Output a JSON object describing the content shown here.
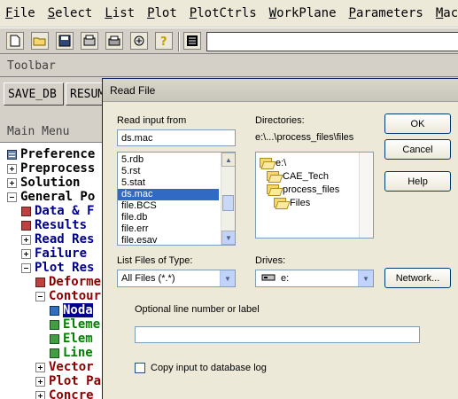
{
  "menubar": {
    "items": [
      "File",
      "Select",
      "List",
      "Plot",
      "PlotCtrls",
      "WorkPlane",
      "Parameters",
      "Macro"
    ]
  },
  "toolstrip": {
    "icons": [
      "new-file-icon",
      "open-file-icon",
      "save-icon",
      "print-setup-icon",
      "print-icon",
      "report-icon",
      "help-icon",
      "command-window-icon"
    ]
  },
  "toolbar": {
    "label": "Toolbar",
    "buttons": [
      "SAVE_DB",
      "RESUM"
    ]
  },
  "main_menu": {
    "label": "Main Menu",
    "items": [
      {
        "label": "Preference"
      },
      {
        "label": "Preprocess"
      },
      {
        "label": "Solution"
      },
      {
        "label": "General Po"
      },
      {
        "label": "Data & F"
      },
      {
        "label": "Results"
      },
      {
        "label": "Read Res"
      },
      {
        "label": "Failure"
      },
      {
        "label": "Plot Res"
      },
      {
        "label": "Deforme"
      },
      {
        "label": "Contour"
      },
      {
        "label": "Noda"
      },
      {
        "label": "Eleme"
      },
      {
        "label": "Elem"
      },
      {
        "label": "Line"
      },
      {
        "label": "Vector"
      },
      {
        "label": "Plot Pa"
      },
      {
        "label": "Concre"
      }
    ]
  },
  "dialog": {
    "title": "Read File",
    "read_input_label": "Read input from",
    "read_input_value": "ds.mac",
    "files": [
      "5.rdb",
      "5.rst",
      "5.stat",
      "ds.mac",
      "file.BCS",
      "file.db",
      "file.err",
      "file.esav"
    ],
    "selected_file": "ds.mac",
    "directories_label": "Directories:",
    "current_path": "e:\\...\\process_files\\files",
    "dirs": [
      "e:\\",
      "CAE_Tech",
      "process_files",
      "Files"
    ],
    "list_files_label": "List Files of Type:",
    "file_type_value": "All Files (*.*)",
    "drives_label": "Drives:",
    "drive_value": "e:",
    "ok_label": "OK",
    "cancel_label": "Cancel",
    "help_label": "Help",
    "network_label": "Network...",
    "optional_line_label": "Optional line number or label",
    "optional_line_value": "",
    "copy_input_label": "Copy input to database log",
    "copy_input_checked": false
  }
}
